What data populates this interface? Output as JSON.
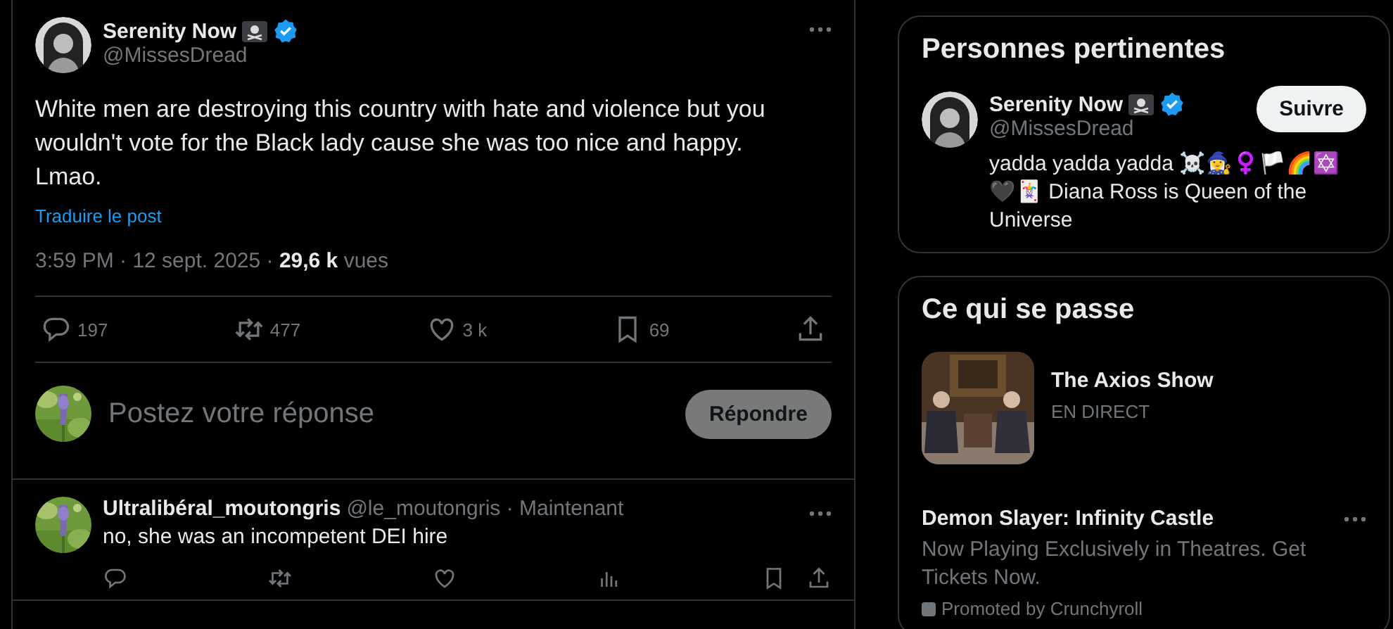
{
  "post": {
    "author": {
      "name": "Serenity Now",
      "handle": "@MissesDread",
      "verified": true
    },
    "text": "White men are destroying this country with hate and violence but you wouldn't vote for the Black lady cause she was too nice and happy. Lmao.",
    "translate_link": "Traduire le post",
    "meta": "3:59 PM · 12 sept. 2025 · **29,6 k** vues",
    "actions": [
      {
        "kind": "reply",
        "count": "197"
      },
      {
        "kind": "repost",
        "count": "477"
      },
      {
        "kind": "like",
        "count": "3 k"
      },
      {
        "kind": "bookmark",
        "count": "69"
      },
      {
        "kind": "share"
      }
    ]
  },
  "composer": {
    "placeholder": "Postez votre réponse",
    "button": "Répondre"
  },
  "replies": [
    {
      "name": "Ultralibéral_moutongris",
      "meta": "@le_moutongris · Maintenant",
      "text": "no, she was an incompetent DEI hire",
      "actions": [
        {
          "kind": "reply"
        },
        {
          "kind": "repost"
        },
        {
          "kind": "like"
        },
        {
          "kind": "views"
        },
        {
          "kind": "bookmark"
        },
        {
          "kind": "share"
        }
      ]
    }
  ],
  "sidebar": {
    "relevant_people": {
      "title": "Personnes pertinentes",
      "people": [
        {
          "name": "Serenity Now",
          "handle": "@MissesDread",
          "verified": true,
          "bio": "yadda yadda yadda ☠️🧙‍♀️♀️🏳️🌈✡️🖤🃏 Diana Ross is Queen of the Universe",
          "follow_button": "Suivre"
        }
      ]
    },
    "happening": {
      "title": "Ce qui se passe",
      "items": [
        {
          "kind": "live",
          "title": "The Axios Show",
          "status": "EN DIRECT"
        },
        {
          "kind": "promoted",
          "title": "Demon Slayer: Infinity Castle",
          "description": "Now Playing Exclusively in Theatres. Get Tickets Now.",
          "promoter": "Promoted by Crunchyroll"
        }
      ]
    }
  }
}
